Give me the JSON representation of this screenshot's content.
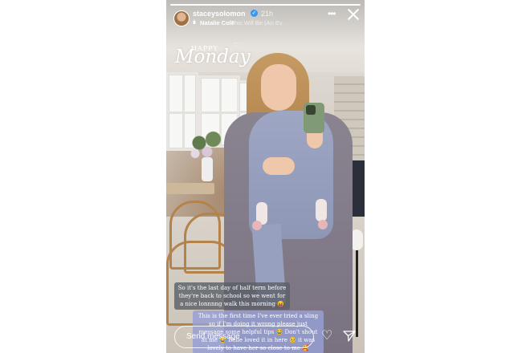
{
  "story": {
    "username": "staceysolomon",
    "timestamp": "21h",
    "music": {
      "artist": "Natalie Cole",
      "song": "This Will Be (An Ev..."
    },
    "sticker": {
      "happy": "HAPPY",
      "monday": "Monday"
    },
    "captions": [
      "So it's the last day of half term before they're back to school so we went for a nice lonnnng walk this morning 😝",
      "This is the first time I've ever tried a sling so if I'm doing it wrong please just message some helpful tips 😂 Don't shout at me 😂 Belle loved it in here 🥺 it was lovely to have her so close to me 🥰"
    ],
    "reply": {
      "placeholder": "Send message"
    },
    "icons": {
      "verified": "verified-badge-icon",
      "music": "music-bars-icon",
      "more": "more-options-icon",
      "close": "close-icon",
      "like": "heart-outline-icon",
      "share": "paper-plane-icon"
    },
    "colors": {
      "verified": "#3897f0",
      "caption_dark": "#5c6068",
      "caption_purple": "#98a0d2"
    }
  }
}
